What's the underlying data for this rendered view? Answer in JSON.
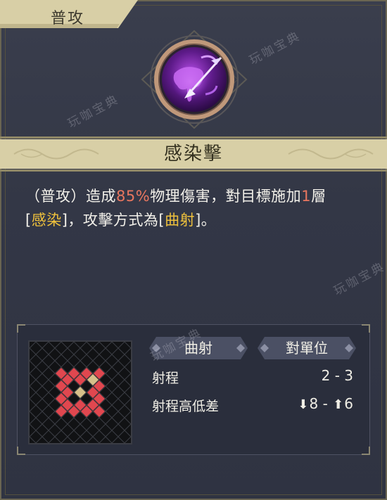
{
  "tab": {
    "label": "普攻"
  },
  "skill": {
    "name": "感染擊",
    "icon": "arrow-infection-icon"
  },
  "description": {
    "p1": "（普攻）造成",
    "damage": "85%",
    "p2": "物理傷害，對目標施加",
    "stacks": "1",
    "p3": "層",
    "bracket_open_1": "[",
    "effect": "感染",
    "p4": "]，攻擊方式為[",
    "attack_type": "曲射",
    "p5": "]。"
  },
  "panel": {
    "tag_attack": "曲射",
    "tag_target": "對單位",
    "range_label": "射程",
    "range_value": "2 - 3",
    "height_label": "射程高低差",
    "height_down": "8",
    "height_up": "6",
    "height_sep": " - "
  },
  "watermark": "玩咖宝典",
  "colors": {
    "highlight_number": "#e8765f",
    "highlight_keyword": "#f0c23c",
    "range_cell": "#e0474f",
    "center_cell": "#d6c08a"
  }
}
